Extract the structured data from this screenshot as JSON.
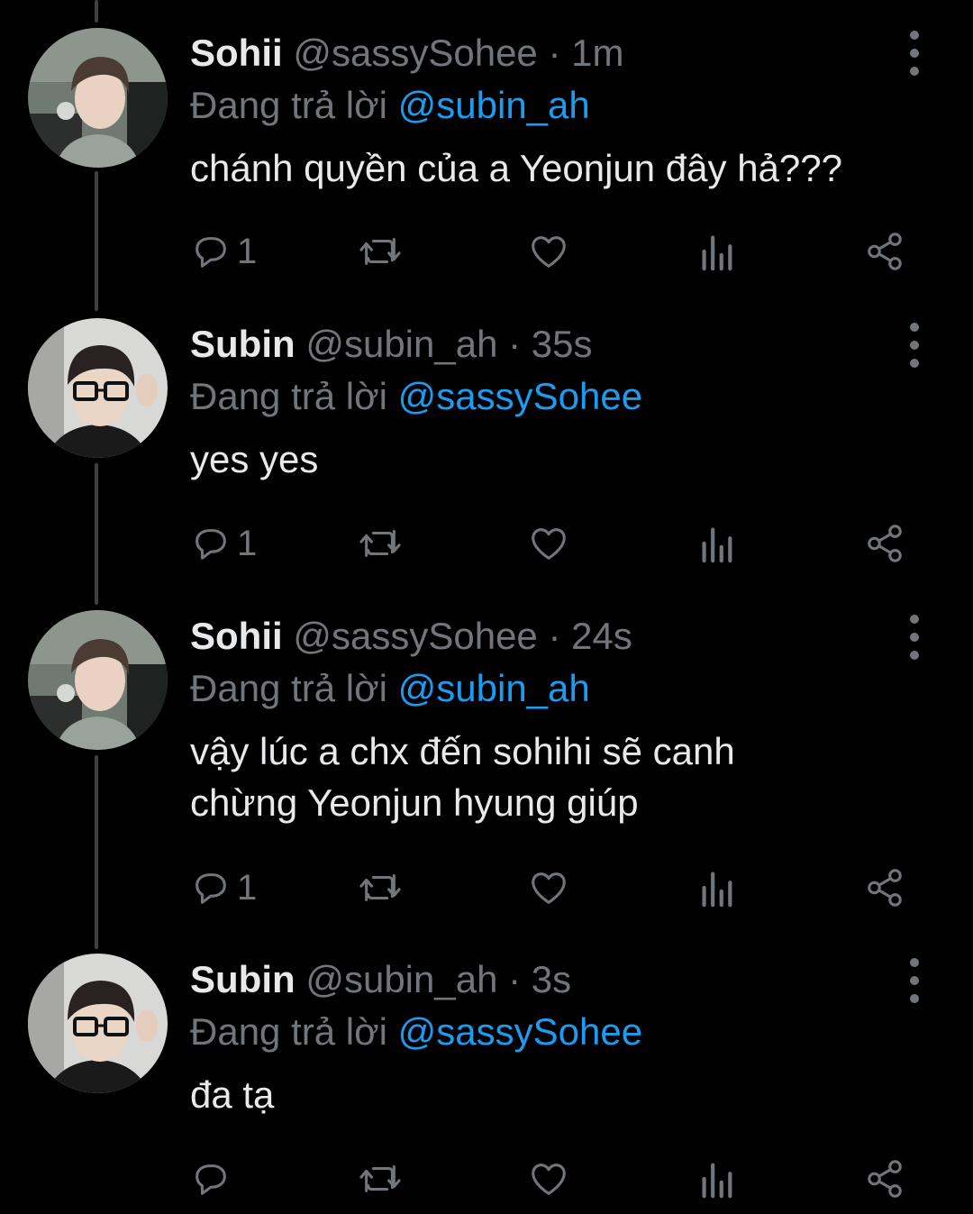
{
  "tweets": [
    {
      "name": "Sohii",
      "handle": "@sassySohee",
      "time": "1m",
      "reply_prefix": "Đang trả lời",
      "reply_to": "@subin_ah",
      "text": "chánh quyền của a Yeonjun đây hả???",
      "reply_count": "1",
      "avatar": "sohii-avatar"
    },
    {
      "name": "Subin",
      "handle": "@subin_ah",
      "time": "35s",
      "reply_prefix": "Đang trả lời",
      "reply_to": "@sassySohee",
      "text": "yes yes",
      "reply_count": "1",
      "avatar": "subin-avatar"
    },
    {
      "name": "Sohii",
      "handle": "@sassySohee",
      "time": "24s",
      "reply_prefix": "Đang trả lời",
      "reply_to": "@subin_ah",
      "text": "vậy lúc a chx đến sohihi sẽ canh chừng Yeonjun hyung giúp",
      "reply_count": "1",
      "avatar": "sohii-avatar"
    },
    {
      "name": "Subin",
      "handle": "@subin_ah",
      "time": "3s",
      "reply_prefix": "Đang trả lời",
      "reply_to": "@sassySohee",
      "text": "đa tạ",
      "reply_count": "",
      "avatar": "subin-avatar"
    }
  ],
  "separator": "·",
  "colors": {
    "background": "#000000",
    "text": "#e7e9ea",
    "muted": "#71767b",
    "mention": "#1d9bf0",
    "thread_line": "#3e4144"
  }
}
